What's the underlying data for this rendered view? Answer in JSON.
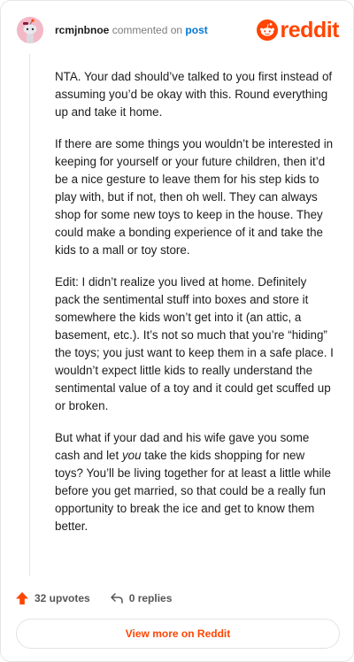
{
  "header": {
    "username": "rcmjnbnoe",
    "action_text": "commented on",
    "post_link": "post",
    "brand": "reddit"
  },
  "comment": {
    "paragraphs": [
      "NTA. Your dad should’ve talked to you first instead of assuming you’d be okay with this. Round everything up and take it home.",
      "If there are some things you wouldn’t be interested in keeping for yourself or your future children, then it’d be a nice gesture to leave them for his step kids to play with, but if not, then oh well. They can always shop for some new toys to keep in the house. They could make a bonding experience of it and take the kids to a mall or toy store.",
      "Edit: I didn’t realize you lived at home. Definitely pack the sentimental stuff into boxes and store it somewhere the kids won’t get into it (an attic, a basement, etc.). It’s not so much that you’re “hiding” the toys; you just want to keep them in a safe place. I wouldn’t expect little kids to really understand the sentimental value of a toy and it could get scuffed up or broken."
    ],
    "last_paragraph": {
      "before": "But what if your dad and his wife gave you some cash and let ",
      "emphasis": "you",
      "after": " take the kids shopping for new toys? You’ll be living together for at least a little while before you get married, so that could be a really fun opportunity to break the ice and get to know them better."
    }
  },
  "footer": {
    "upvotes": "32 upvotes",
    "replies": "0 replies"
  },
  "cta": {
    "label": "View more on Reddit"
  },
  "colors": {
    "brand": "#ff4500",
    "link": "#0079d3",
    "avatar_bg": "#f3b8c5"
  },
  "icons": [
    "snoo-avatar-icon",
    "reddit-logo-icon",
    "upvote-arrow-icon",
    "reply-arrow-icon"
  ]
}
